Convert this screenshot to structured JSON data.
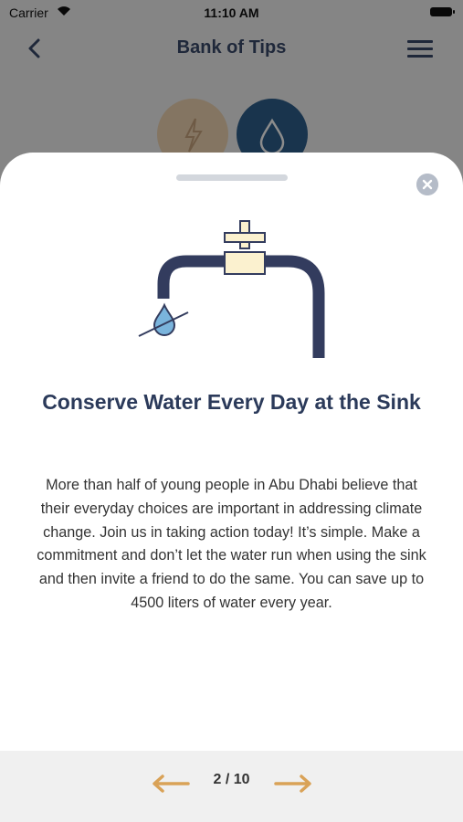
{
  "status": {
    "carrier": "Carrier",
    "time": "11:10 AM"
  },
  "nav": {
    "title": "Bank of Tips"
  },
  "tip": {
    "title": "Conserve Water Every Day at the Sink",
    "body": "More than half of young people in Abu Dhabi believe that their everyday choices are important in addressing climate change. Join us in taking action today! It’s simple. Make a commitment and don’t let the water run when using the sink and then invite a friend to do the same. You can save up to 4500 liters of water every year."
  },
  "pager": {
    "label": "2 / 10"
  },
  "colors": {
    "navy": "#3a4a6b",
    "water_blue": "#2f5f8c",
    "arrow_gold": "#d9a257",
    "faucet_handle": "#fbf1cf"
  },
  "icons": {
    "back": "chevron-left-icon",
    "menu": "hamburger-icon",
    "close": "close-icon",
    "prev": "arrow-left-icon",
    "next": "arrow-right-icon"
  }
}
